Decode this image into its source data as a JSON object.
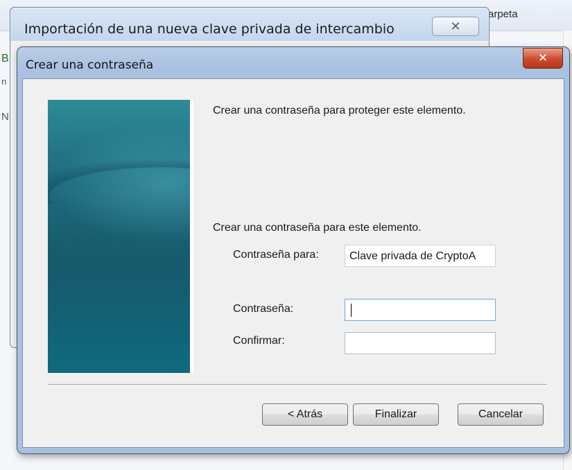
{
  "background": {
    "title_fragment": "arpeta",
    "left_fragments": [
      "B",
      "n",
      "N"
    ]
  },
  "back_window": {
    "title": "Importación de una nueva clave privada de intercambio",
    "close_glyph": "✕"
  },
  "dialog": {
    "title": "Crear una contraseña",
    "close_glyph": "✕",
    "intro_text": "Crear una contraseña para proteger este elemento.",
    "section_label": "Crear una contraseña para este elemento.",
    "password_for_label": "Contraseña para:",
    "password_for_value": "Clave privada de CryptoA",
    "password_label": "Contraseña:",
    "password_value": "",
    "confirm_label": "Confirmar:",
    "confirm_value": "",
    "buttons": {
      "back": "< Atrás",
      "finish": "Finalizar",
      "cancel": "Cancelar"
    }
  },
  "colors": {
    "title_close_red": "#cc4a2c",
    "wizard_teal": "#16596b",
    "dialog_frame_blue": "#a9c1e0"
  }
}
